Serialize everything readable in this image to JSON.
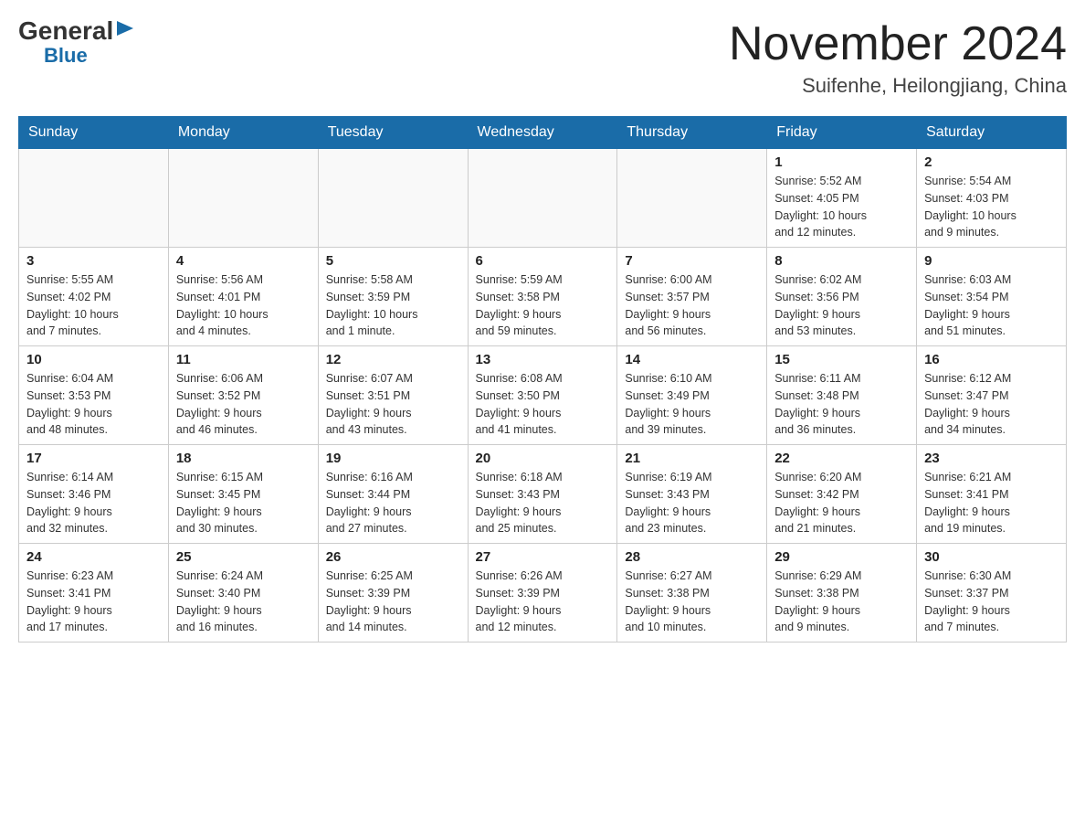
{
  "header": {
    "logo_general": "General",
    "logo_blue": "Blue",
    "month_title": "November 2024",
    "location": "Suifenhe, Heilongjiang, China"
  },
  "days_of_week": [
    "Sunday",
    "Monday",
    "Tuesday",
    "Wednesday",
    "Thursday",
    "Friday",
    "Saturday"
  ],
  "weeks": [
    [
      {
        "day": "",
        "info": ""
      },
      {
        "day": "",
        "info": ""
      },
      {
        "day": "",
        "info": ""
      },
      {
        "day": "",
        "info": ""
      },
      {
        "day": "",
        "info": ""
      },
      {
        "day": "1",
        "info": "Sunrise: 5:52 AM\nSunset: 4:05 PM\nDaylight: 10 hours\nand 12 minutes."
      },
      {
        "day": "2",
        "info": "Sunrise: 5:54 AM\nSunset: 4:03 PM\nDaylight: 10 hours\nand 9 minutes."
      }
    ],
    [
      {
        "day": "3",
        "info": "Sunrise: 5:55 AM\nSunset: 4:02 PM\nDaylight: 10 hours\nand 7 minutes."
      },
      {
        "day": "4",
        "info": "Sunrise: 5:56 AM\nSunset: 4:01 PM\nDaylight: 10 hours\nand 4 minutes."
      },
      {
        "day": "5",
        "info": "Sunrise: 5:58 AM\nSunset: 3:59 PM\nDaylight: 10 hours\nand 1 minute."
      },
      {
        "day": "6",
        "info": "Sunrise: 5:59 AM\nSunset: 3:58 PM\nDaylight: 9 hours\nand 59 minutes."
      },
      {
        "day": "7",
        "info": "Sunrise: 6:00 AM\nSunset: 3:57 PM\nDaylight: 9 hours\nand 56 minutes."
      },
      {
        "day": "8",
        "info": "Sunrise: 6:02 AM\nSunset: 3:56 PM\nDaylight: 9 hours\nand 53 minutes."
      },
      {
        "day": "9",
        "info": "Sunrise: 6:03 AM\nSunset: 3:54 PM\nDaylight: 9 hours\nand 51 minutes."
      }
    ],
    [
      {
        "day": "10",
        "info": "Sunrise: 6:04 AM\nSunset: 3:53 PM\nDaylight: 9 hours\nand 48 minutes."
      },
      {
        "day": "11",
        "info": "Sunrise: 6:06 AM\nSunset: 3:52 PM\nDaylight: 9 hours\nand 46 minutes."
      },
      {
        "day": "12",
        "info": "Sunrise: 6:07 AM\nSunset: 3:51 PM\nDaylight: 9 hours\nand 43 minutes."
      },
      {
        "day": "13",
        "info": "Sunrise: 6:08 AM\nSunset: 3:50 PM\nDaylight: 9 hours\nand 41 minutes."
      },
      {
        "day": "14",
        "info": "Sunrise: 6:10 AM\nSunset: 3:49 PM\nDaylight: 9 hours\nand 39 minutes."
      },
      {
        "day": "15",
        "info": "Sunrise: 6:11 AM\nSunset: 3:48 PM\nDaylight: 9 hours\nand 36 minutes."
      },
      {
        "day": "16",
        "info": "Sunrise: 6:12 AM\nSunset: 3:47 PM\nDaylight: 9 hours\nand 34 minutes."
      }
    ],
    [
      {
        "day": "17",
        "info": "Sunrise: 6:14 AM\nSunset: 3:46 PM\nDaylight: 9 hours\nand 32 minutes."
      },
      {
        "day": "18",
        "info": "Sunrise: 6:15 AM\nSunset: 3:45 PM\nDaylight: 9 hours\nand 30 minutes."
      },
      {
        "day": "19",
        "info": "Sunrise: 6:16 AM\nSunset: 3:44 PM\nDaylight: 9 hours\nand 27 minutes."
      },
      {
        "day": "20",
        "info": "Sunrise: 6:18 AM\nSunset: 3:43 PM\nDaylight: 9 hours\nand 25 minutes."
      },
      {
        "day": "21",
        "info": "Sunrise: 6:19 AM\nSunset: 3:43 PM\nDaylight: 9 hours\nand 23 minutes."
      },
      {
        "day": "22",
        "info": "Sunrise: 6:20 AM\nSunset: 3:42 PM\nDaylight: 9 hours\nand 21 minutes."
      },
      {
        "day": "23",
        "info": "Sunrise: 6:21 AM\nSunset: 3:41 PM\nDaylight: 9 hours\nand 19 minutes."
      }
    ],
    [
      {
        "day": "24",
        "info": "Sunrise: 6:23 AM\nSunset: 3:41 PM\nDaylight: 9 hours\nand 17 minutes."
      },
      {
        "day": "25",
        "info": "Sunrise: 6:24 AM\nSunset: 3:40 PM\nDaylight: 9 hours\nand 16 minutes."
      },
      {
        "day": "26",
        "info": "Sunrise: 6:25 AM\nSunset: 3:39 PM\nDaylight: 9 hours\nand 14 minutes."
      },
      {
        "day": "27",
        "info": "Sunrise: 6:26 AM\nSunset: 3:39 PM\nDaylight: 9 hours\nand 12 minutes."
      },
      {
        "day": "28",
        "info": "Sunrise: 6:27 AM\nSunset: 3:38 PM\nDaylight: 9 hours\nand 10 minutes."
      },
      {
        "day": "29",
        "info": "Sunrise: 6:29 AM\nSunset: 3:38 PM\nDaylight: 9 hours\nand 9 minutes."
      },
      {
        "day": "30",
        "info": "Sunrise: 6:30 AM\nSunset: 3:37 PM\nDaylight: 9 hours\nand 7 minutes."
      }
    ]
  ]
}
